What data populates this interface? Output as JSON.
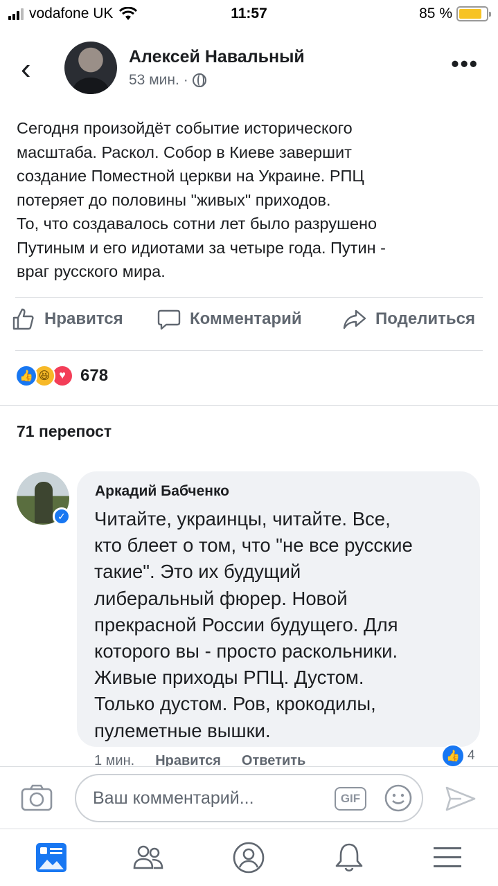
{
  "status_bar": {
    "carrier": "vodafone UK",
    "time": "11:57",
    "battery_percent": "85 %",
    "battery_level": 0.85
  },
  "post": {
    "author": "Алексей Навальный",
    "time": "53 мин.",
    "separator": "·",
    "text": "Сегодня произойдёт событие исторического\nмасштаба. Раскол. Собор в Киеве завершит\nсоздание Поместной церкви на Украине. РПЦ\nпотеряет до половины \"живых\" приходов.\nТо, что создавалось сотни лет было разрушено\nПутиным и его идиотами за четыре года. Путин -\nвраг русского мира."
  },
  "actions": {
    "like": "Нравится",
    "comment": "Комментарий",
    "share": "Поделиться"
  },
  "reactions": {
    "count": "678",
    "types": [
      "like",
      "haha",
      "love"
    ]
  },
  "reposts": "71 перепост",
  "comment": {
    "author": "Аркадий Бабченко",
    "text": "Читайте, украинцы, читайте. Все,\nкто блеет о том, что \"не все русские\nтакие\". Это их будущий\nлиберальный фюрер. Новой\nпрекрасной России будущего. Для\nкоторого вы - просто раскольники.\nЖивые приходы РПЦ. Дустом.\nТолько дустом. Ров, крокодилы,\nпулеметные вышки.",
    "time": "1 мин.",
    "like_label": "Нравится",
    "reply_label": "Ответить",
    "like_count": "4"
  },
  "composer": {
    "placeholder": "Ваш комментарий...",
    "gif_label": "GIF"
  },
  "colors": {
    "accent": "#1877f2",
    "secondary_text": "#606770",
    "bubble": "#f0f2f5",
    "battery": "#f7c325"
  },
  "icons": [
    "back-icon",
    "more-icon",
    "globe-icon",
    "like-icon",
    "comment-icon",
    "share-icon",
    "camera-icon",
    "gif-icon",
    "emoji-icon",
    "send-icon",
    "news-feed-icon",
    "friends-icon",
    "profile-icon",
    "notifications-icon",
    "menu-icon"
  ]
}
